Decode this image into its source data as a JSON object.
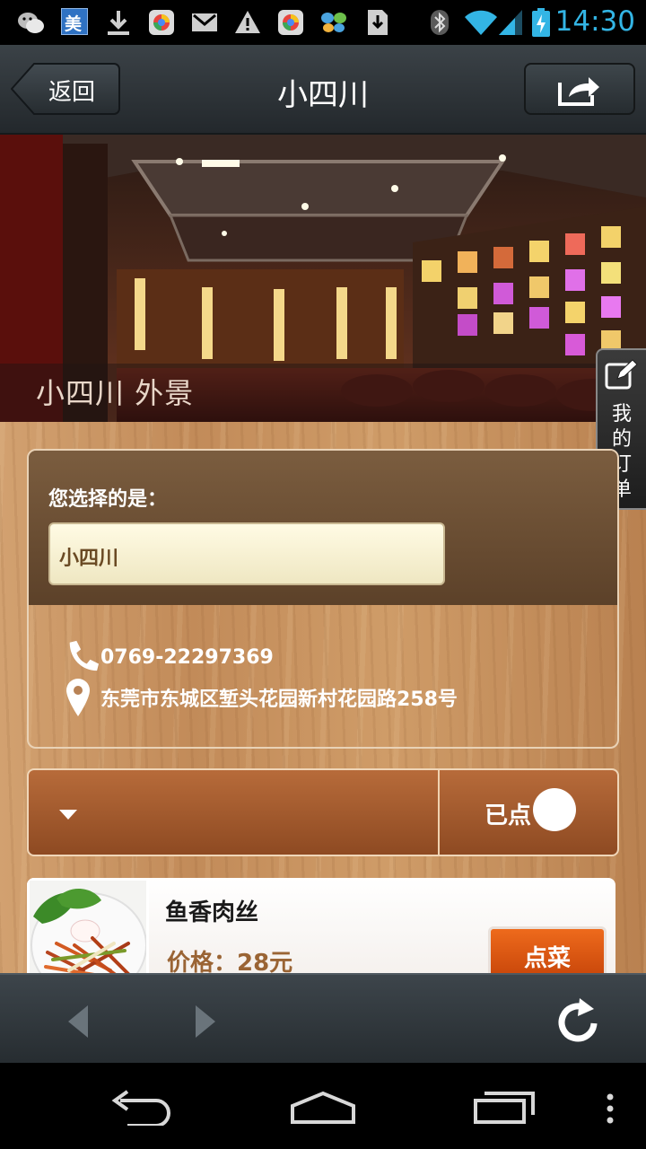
{
  "status_bar": {
    "time": "14:30",
    "meituan_label": "美",
    "icons": [
      "wechat-icon",
      "meituan-icon",
      "download-icon",
      "app-icon",
      "gmail-icon",
      "warning-icon",
      "app-icon",
      "butterfly-icon",
      "sd-download-icon",
      "bluetooth-icon",
      "wifi-icon",
      "signal-icon",
      "battery-charging-icon"
    ],
    "accent": "#33b5e5"
  },
  "header": {
    "back_label": "返回",
    "title": "小四川",
    "share_icon": "share-icon"
  },
  "banner": {
    "caption": "小四川 外景"
  },
  "order_tab": {
    "chars": [
      "我",
      "的",
      "订",
      "单"
    ],
    "icon": "edit-icon"
  },
  "info": {
    "choice_label": "您选择的是：",
    "choice_value": "小四川",
    "phone": "0769-22297369",
    "address": "东莞市东城区堑头花园新村花园路258号"
  },
  "filter": {
    "ordered_label": "已点",
    "dropdown_icon": "dropdown-arrow-icon"
  },
  "dish": {
    "name": "鱼香肉丝",
    "price": "价格：28元",
    "order_label": "点菜"
  },
  "colors": {
    "order_button": "#e0601a",
    "filter_bar": "#a85c30",
    "title_bar": "#2f363a"
  }
}
